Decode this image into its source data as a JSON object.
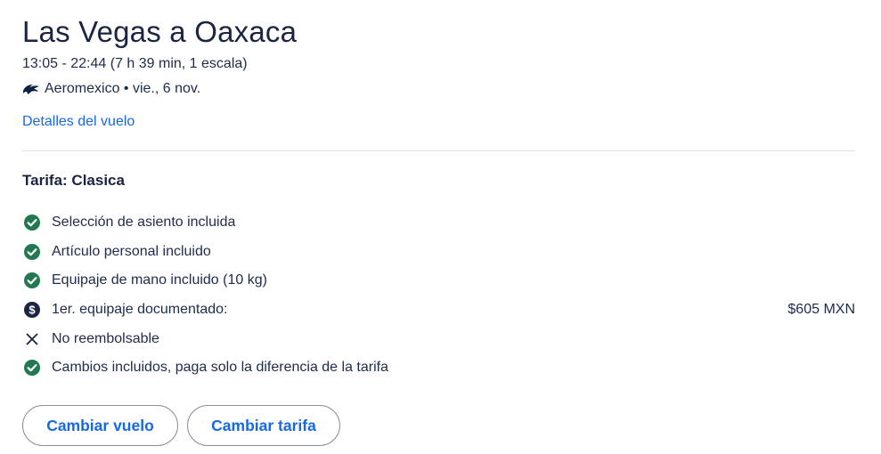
{
  "header": {
    "title": "Las Vegas a Oaxaca",
    "times": "13:05 - 22:44 (7 h 39 min, 1 escala)",
    "airline_info": "Aeromexico • vie., 6 nov.",
    "airline_logo_icon": "aeromexico-logo-icon",
    "details_link": "Detalles del vuelo"
  },
  "fare": {
    "title": "Tarifa: Clasica",
    "features": [
      {
        "icon": "check-circle-icon",
        "label": "Selección de asiento incluida",
        "price": ""
      },
      {
        "icon": "check-circle-icon",
        "label": "Artículo personal incluido",
        "price": ""
      },
      {
        "icon": "check-circle-icon",
        "label": "Equipaje de mano incluido (10 kg)",
        "price": ""
      },
      {
        "icon": "dollar-circle-icon",
        "label": "1er. equipaje documentado:",
        "price": "$605 MXN"
      },
      {
        "icon": "close-x-icon",
        "label": "No reembolsable",
        "price": ""
      },
      {
        "icon": "check-circle-icon",
        "label": "Cambios incluidos, paga solo la diferencia de la tarifa",
        "price": ""
      }
    ]
  },
  "actions": {
    "change_flight": "Cambiar vuelo",
    "change_fare": "Cambiar tarifa"
  },
  "colors": {
    "accent_link": "#1668e3",
    "check_green": "#227950",
    "text_dark": "#1f2b4d"
  }
}
